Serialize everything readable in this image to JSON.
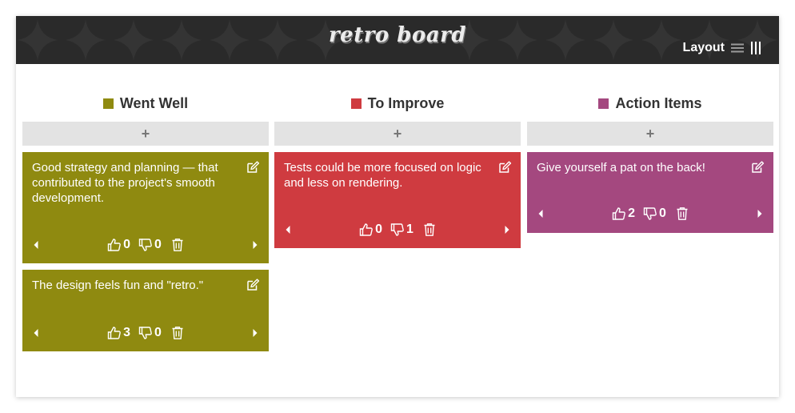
{
  "app": {
    "title": "retro board"
  },
  "header": {
    "layout_label": "Layout"
  },
  "colors": {
    "went_well": "#8f8a10",
    "to_improve": "#cf3b40",
    "action_items": "#a4487f",
    "header_bg": "#2a2a2a",
    "add_bg": "#e3e3e3"
  },
  "columns": [
    {
      "title": "Went Well",
      "add_label": "+",
      "cards": [
        {
          "text": "Good strategy and planning — that contributed to the project's smooth development.",
          "likes": "0",
          "dislikes": "0"
        },
        {
          "text": "The design feels fun and \"retro.\"",
          "likes": "3",
          "dislikes": "0"
        }
      ]
    },
    {
      "title": "To Improve",
      "add_label": "+",
      "cards": [
        {
          "text": "Tests could be more focused on logic and less on rendering.",
          "likes": "0",
          "dislikes": "1"
        }
      ]
    },
    {
      "title": "Action Items",
      "add_label": "+",
      "cards": [
        {
          "text": "Give yourself a pat on the back!",
          "likes": "2",
          "dislikes": "0"
        }
      ]
    }
  ],
  "icons": {
    "layout": [
      "list-layout-icon",
      "columns-layout-icon"
    ],
    "card": [
      "edit-icon",
      "arrow-left-icon",
      "thumbs-up-icon",
      "thumbs-down-icon",
      "trash-icon",
      "arrow-right-icon"
    ]
  }
}
